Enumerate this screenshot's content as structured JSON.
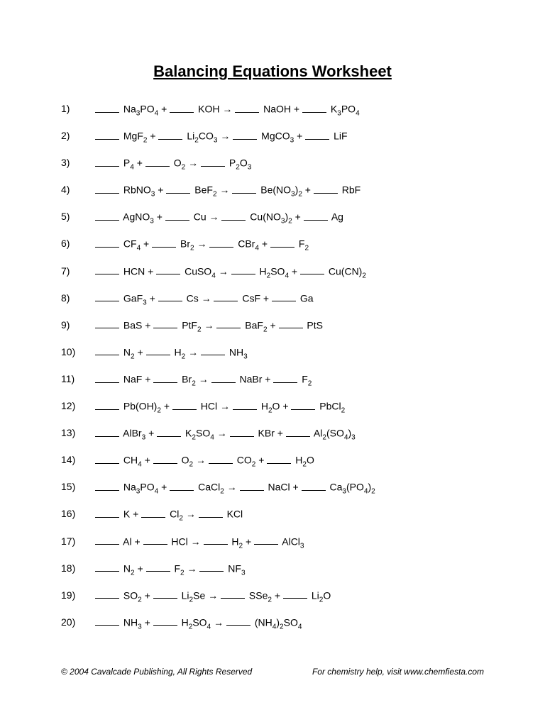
{
  "title": "Balancing Equations Worksheet",
  "arrow": "→",
  "blank_html": "<span class=\"blank\"></span>",
  "equations": [
    {
      "n": "1)",
      "terms": [
        "Na<sub>3</sub>PO<sub>4</sub>",
        "KOH",
        "ARROW",
        "NaOH",
        "K<sub>3</sub>PO<sub>4</sub>"
      ]
    },
    {
      "n": "2)",
      "terms": [
        "MgF<sub>2</sub>",
        "Li<sub>2</sub>CO<sub>3</sub>",
        "ARROW",
        "MgCO<sub>3</sub>",
        "LiF"
      ]
    },
    {
      "n": "3)",
      "terms": [
        "P<sub>4</sub>",
        "O<sub>2</sub>",
        "ARROW",
        "P<sub>2</sub>O<sub>3</sub>"
      ]
    },
    {
      "n": "4)",
      "terms": [
        "RbNO<sub>3</sub>",
        "BeF<sub>2</sub>",
        "ARROW",
        "Be(NO<sub>3</sub>)<sub>2</sub>",
        "RbF"
      ]
    },
    {
      "n": "5)",
      "terms": [
        "AgNO<sub>3</sub>",
        "Cu",
        "ARROW",
        "Cu(NO<sub>3</sub>)<sub>2</sub>",
        "Ag"
      ]
    },
    {
      "n": "6)",
      "terms": [
        "CF<sub>4</sub>",
        "Br<sub>2</sub>",
        "ARROW",
        "CBr<sub>4</sub>",
        "F<sub>2</sub>"
      ]
    },
    {
      "n": "7)",
      "terms": [
        "HCN",
        "CuSO<sub>4</sub>",
        "ARROW",
        "H<sub>2</sub>SO<sub>4</sub>",
        "Cu(CN)<sub>2</sub>"
      ]
    },
    {
      "n": "8)",
      "terms": [
        "GaF<sub>3</sub>",
        "Cs",
        "ARROW",
        "CsF",
        "Ga"
      ]
    },
    {
      "n": "9)",
      "terms": [
        "BaS",
        "PtF<sub>2</sub>",
        "ARROW",
        "BaF<sub>2</sub>",
        "PtS"
      ]
    },
    {
      "n": "10)",
      "terms": [
        "N<sub>2</sub>",
        "H<sub>2</sub>",
        "ARROW",
        "NH<sub>3</sub>"
      ]
    },
    {
      "n": "11)",
      "terms": [
        "NaF",
        "Br<sub>2</sub>",
        "ARROW",
        "NaBr",
        "F<sub>2</sub>"
      ]
    },
    {
      "n": "12)",
      "terms": [
        "Pb(OH)<sub>2</sub>",
        "HCl",
        "ARROW",
        "H<sub>2</sub>O",
        "PbCl<sub>2</sub>"
      ]
    },
    {
      "n": "13)",
      "terms": [
        "AlBr<sub>3</sub>",
        "K<sub>2</sub>SO<sub>4</sub>",
        "ARROW",
        "KBr",
        "Al<sub>2</sub>(SO<sub>4</sub>)<sub>3</sub>"
      ]
    },
    {
      "n": "14)",
      "terms": [
        "CH<sub>4</sub>",
        "O<sub>2</sub>",
        "ARROW",
        "CO<sub>2</sub>",
        "H<sub>2</sub>O"
      ]
    },
    {
      "n": "15)",
      "terms": [
        "Na<sub>3</sub>PO<sub>4</sub>",
        "CaCl<sub>2</sub>",
        "ARROW",
        "NaCl",
        "Ca<sub>3</sub>(PO<sub>4</sub>)<sub>2</sub>"
      ]
    },
    {
      "n": "16)",
      "terms": [
        "K",
        "Cl<sub>2</sub>",
        "ARROW",
        "KCl"
      ]
    },
    {
      "n": "17)",
      "terms": [
        "Al",
        "HCl",
        "ARROW",
        "H<sub>2</sub>",
        "AlCl<sub>3</sub>"
      ]
    },
    {
      "n": "18)",
      "terms": [
        "N<sub>2</sub>",
        "F<sub>2</sub>",
        "ARROW",
        "NF<sub>3</sub>"
      ]
    },
    {
      "n": "19)",
      "terms": [
        "SO<sub>2</sub>",
        "Li<sub>2</sub>Se",
        "ARROW",
        "SSe<sub>2</sub>",
        "Li<sub>2</sub>O"
      ]
    },
    {
      "n": "20)",
      "terms": [
        "NH<sub>3</sub>",
        "H<sub>2</sub>SO<sub>4</sub>",
        "ARROW",
        "(NH<sub>4</sub>)<sub>2</sub>SO<sub>4</sub>"
      ]
    }
  ],
  "footer": {
    "left": "© 2004 Cavalcade Publishing, All Rights Reserved",
    "right": "For chemistry help, visit www.chemfiesta.com"
  }
}
